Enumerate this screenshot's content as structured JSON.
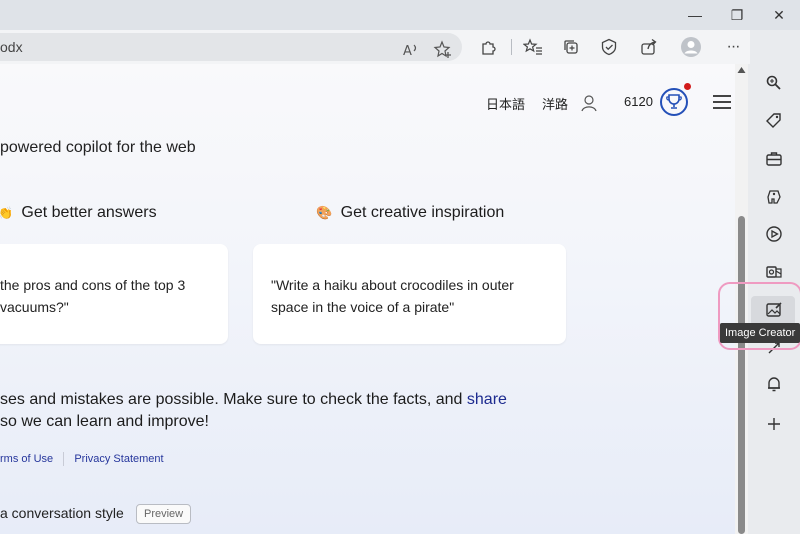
{
  "window": {
    "minimize_glyph": "—",
    "restore_glyph": "❐",
    "close_glyph": "✕"
  },
  "addressbar": {
    "url_fragment": "odx"
  },
  "toolbar": {
    "icons": [
      "read-aloud-icon",
      "add-favorite-icon",
      "extensions-icon",
      "favorites-icon",
      "collections-icon",
      "browser-essentials-icon",
      "share-icon",
      "profile-icon",
      "more-icon",
      "bing-copilot-icon"
    ],
    "more_glyph": "···",
    "read_aloud_glyph": "A"
  },
  "header": {
    "lang_label": "日本語",
    "region_label": "洋路",
    "points": "6120"
  },
  "main": {
    "tagline": "powered copilot for the web",
    "features": [
      {
        "emoji": "👏",
        "title": "Get better answers",
        "card_text": "the pros and cons of the top 3\nvacuums?\""
      },
      {
        "emoji": "🎨",
        "title": "Get creative inspiration",
        "card_text": "\"Write a haiku about crocodiles in outer\nspace in the voice of a pirate\""
      }
    ],
    "disclaimer_line1": "ses and mistakes are possible. Make sure to check the facts, and ",
    "disclaimer_link": "share",
    "disclaimer_line2": " so we can learn and improve!",
    "terms_link": "rms of Use",
    "privacy_link": "Privacy Statement",
    "style_label": " a conversation style",
    "preview_chip": "Preview"
  },
  "sidebar": {
    "items": [
      "search-icon",
      "shopping-tag-icon",
      "tools-icon",
      "games-icon",
      "copilot-play-icon",
      "outlook-icon",
      "image-creator-icon",
      "drop-icon",
      "notifications-icon",
      "add-icon"
    ],
    "tooltip": "Image Creator"
  },
  "colors": {
    "accent": "#1f6ae0",
    "link": "#1c2a8f",
    "rewards": "#2450b8",
    "highlight_ring": "#ef9ac1"
  }
}
